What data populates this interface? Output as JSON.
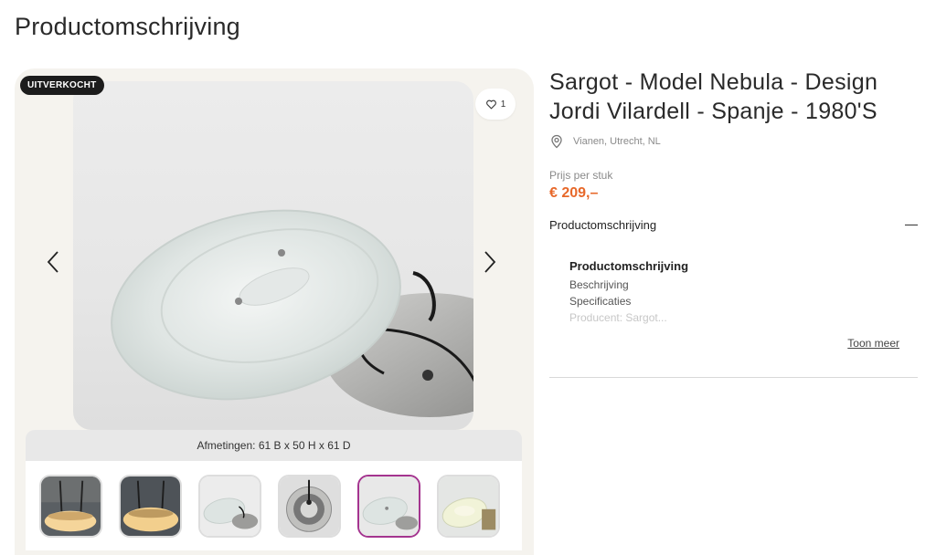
{
  "page": {
    "heading": "Productomschrijving"
  },
  "gallery": {
    "badge": "UITVERKOCHT",
    "favorite_count": "1",
    "dimensions": "Afmetingen: 61 B x 50 H x 61 D",
    "thumbnails": [
      {
        "name": "thumbnail-1",
        "active": false
      },
      {
        "name": "thumbnail-2",
        "active": false
      },
      {
        "name": "thumbnail-3",
        "active": false
      },
      {
        "name": "thumbnail-4",
        "active": false
      },
      {
        "name": "thumbnail-5",
        "active": true
      },
      {
        "name": "thumbnail-6",
        "active": false
      }
    ]
  },
  "product": {
    "title_line1": "Sargot - Model Nebula - Design",
    "title_line2": "Jordi Vilardell - Spanje - 1980'S",
    "location": "Vianen, Utrecht, NL",
    "price_label": "Prijs per stuk",
    "price": "€ 209,–"
  },
  "description": {
    "accordion_title": "Productomschrijving",
    "heading": "Productomschrijving",
    "lines": [
      "Beschrijving",
      "Specificaties",
      "Producent: Sargot..."
    ],
    "more_link": "Toon meer"
  },
  "colors": {
    "accent": "#e7682a",
    "active_thumb": "#a4348f",
    "badge_bg": "#1c1c1c"
  }
}
